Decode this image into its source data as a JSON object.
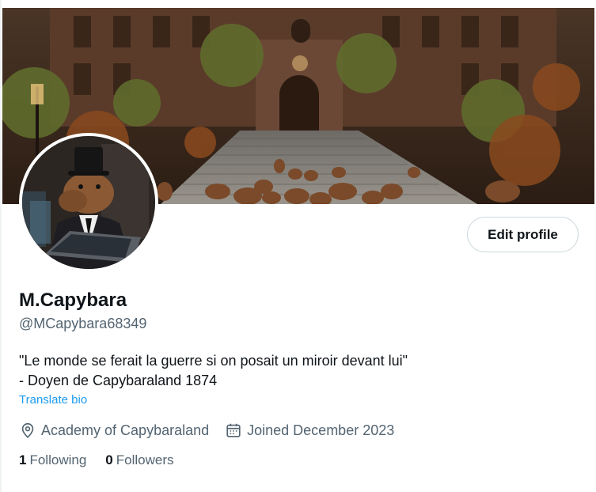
{
  "profile": {
    "name": "M.Capybara",
    "handle": "@MCapybara68349",
    "bio_line1": "\"Le monde se ferait la guerre si on posait un miroir devant lui\"",
    "bio_line2": "- Doyen de Capybaraland 1874",
    "translate_label": "Translate bio",
    "location": "Academy of Capybaraland",
    "joined": "Joined December 2023"
  },
  "actions": {
    "edit_profile_label": "Edit profile"
  },
  "stats": {
    "following_count": "1",
    "following_label": "Following",
    "followers_count": "0",
    "followers_label": "Followers"
  },
  "icons": {
    "location": "location-pin-icon",
    "joined": "calendar-icon"
  },
  "colors": {
    "text_primary": "#0f1419",
    "text_secondary": "#536471",
    "link": "#1d9bf0",
    "border": "#cfd9de"
  }
}
